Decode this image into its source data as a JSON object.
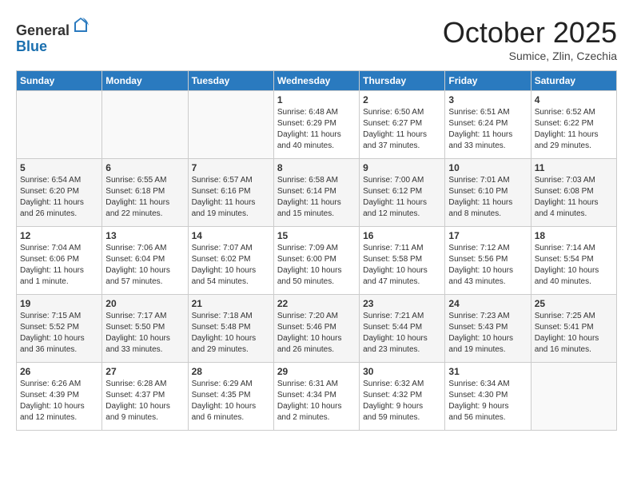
{
  "header": {
    "logo_general": "General",
    "logo_blue": "Blue",
    "month": "October 2025",
    "location": "Sumice, Zlin, Czechia"
  },
  "weekdays": [
    "Sunday",
    "Monday",
    "Tuesday",
    "Wednesday",
    "Thursday",
    "Friday",
    "Saturday"
  ],
  "weeks": [
    [
      {
        "day": "",
        "info": ""
      },
      {
        "day": "",
        "info": ""
      },
      {
        "day": "",
        "info": ""
      },
      {
        "day": "1",
        "info": "Sunrise: 6:48 AM\nSunset: 6:29 PM\nDaylight: 11 hours\nand 40 minutes."
      },
      {
        "day": "2",
        "info": "Sunrise: 6:50 AM\nSunset: 6:27 PM\nDaylight: 11 hours\nand 37 minutes."
      },
      {
        "day": "3",
        "info": "Sunrise: 6:51 AM\nSunset: 6:24 PM\nDaylight: 11 hours\nand 33 minutes."
      },
      {
        "day": "4",
        "info": "Sunrise: 6:52 AM\nSunset: 6:22 PM\nDaylight: 11 hours\nand 29 minutes."
      }
    ],
    [
      {
        "day": "5",
        "info": "Sunrise: 6:54 AM\nSunset: 6:20 PM\nDaylight: 11 hours\nand 26 minutes."
      },
      {
        "day": "6",
        "info": "Sunrise: 6:55 AM\nSunset: 6:18 PM\nDaylight: 11 hours\nand 22 minutes."
      },
      {
        "day": "7",
        "info": "Sunrise: 6:57 AM\nSunset: 6:16 PM\nDaylight: 11 hours\nand 19 minutes."
      },
      {
        "day": "8",
        "info": "Sunrise: 6:58 AM\nSunset: 6:14 PM\nDaylight: 11 hours\nand 15 minutes."
      },
      {
        "day": "9",
        "info": "Sunrise: 7:00 AM\nSunset: 6:12 PM\nDaylight: 11 hours\nand 12 minutes."
      },
      {
        "day": "10",
        "info": "Sunrise: 7:01 AM\nSunset: 6:10 PM\nDaylight: 11 hours\nand 8 minutes."
      },
      {
        "day": "11",
        "info": "Sunrise: 7:03 AM\nSunset: 6:08 PM\nDaylight: 11 hours\nand 4 minutes."
      }
    ],
    [
      {
        "day": "12",
        "info": "Sunrise: 7:04 AM\nSunset: 6:06 PM\nDaylight: 11 hours\nand 1 minute."
      },
      {
        "day": "13",
        "info": "Sunrise: 7:06 AM\nSunset: 6:04 PM\nDaylight: 10 hours\nand 57 minutes."
      },
      {
        "day": "14",
        "info": "Sunrise: 7:07 AM\nSunset: 6:02 PM\nDaylight: 10 hours\nand 54 minutes."
      },
      {
        "day": "15",
        "info": "Sunrise: 7:09 AM\nSunset: 6:00 PM\nDaylight: 10 hours\nand 50 minutes."
      },
      {
        "day": "16",
        "info": "Sunrise: 7:11 AM\nSunset: 5:58 PM\nDaylight: 10 hours\nand 47 minutes."
      },
      {
        "day": "17",
        "info": "Sunrise: 7:12 AM\nSunset: 5:56 PM\nDaylight: 10 hours\nand 43 minutes."
      },
      {
        "day": "18",
        "info": "Sunrise: 7:14 AM\nSunset: 5:54 PM\nDaylight: 10 hours\nand 40 minutes."
      }
    ],
    [
      {
        "day": "19",
        "info": "Sunrise: 7:15 AM\nSunset: 5:52 PM\nDaylight: 10 hours\nand 36 minutes."
      },
      {
        "day": "20",
        "info": "Sunrise: 7:17 AM\nSunset: 5:50 PM\nDaylight: 10 hours\nand 33 minutes."
      },
      {
        "day": "21",
        "info": "Sunrise: 7:18 AM\nSunset: 5:48 PM\nDaylight: 10 hours\nand 29 minutes."
      },
      {
        "day": "22",
        "info": "Sunrise: 7:20 AM\nSunset: 5:46 PM\nDaylight: 10 hours\nand 26 minutes."
      },
      {
        "day": "23",
        "info": "Sunrise: 7:21 AM\nSunset: 5:44 PM\nDaylight: 10 hours\nand 23 minutes."
      },
      {
        "day": "24",
        "info": "Sunrise: 7:23 AM\nSunset: 5:43 PM\nDaylight: 10 hours\nand 19 minutes."
      },
      {
        "day": "25",
        "info": "Sunrise: 7:25 AM\nSunset: 5:41 PM\nDaylight: 10 hours\nand 16 minutes."
      }
    ],
    [
      {
        "day": "26",
        "info": "Sunrise: 6:26 AM\nSunset: 4:39 PM\nDaylight: 10 hours\nand 12 minutes."
      },
      {
        "day": "27",
        "info": "Sunrise: 6:28 AM\nSunset: 4:37 PM\nDaylight: 10 hours\nand 9 minutes."
      },
      {
        "day": "28",
        "info": "Sunrise: 6:29 AM\nSunset: 4:35 PM\nDaylight: 10 hours\nand 6 minutes."
      },
      {
        "day": "29",
        "info": "Sunrise: 6:31 AM\nSunset: 4:34 PM\nDaylight: 10 hours\nand 2 minutes."
      },
      {
        "day": "30",
        "info": "Sunrise: 6:32 AM\nSunset: 4:32 PM\nDaylight: 9 hours\nand 59 minutes."
      },
      {
        "day": "31",
        "info": "Sunrise: 6:34 AM\nSunset: 4:30 PM\nDaylight: 9 hours\nand 56 minutes."
      },
      {
        "day": "",
        "info": ""
      }
    ]
  ]
}
